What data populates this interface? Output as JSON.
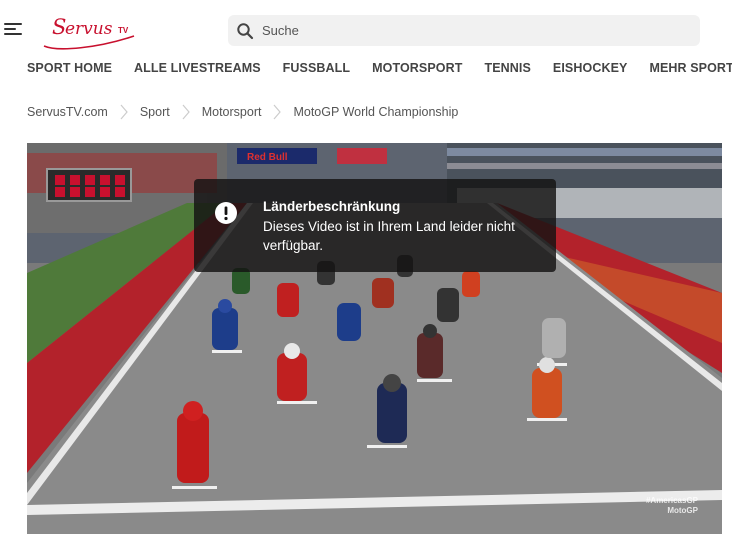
{
  "header": {
    "search_placeholder": "Suche",
    "logo_text": "ServusTV"
  },
  "nav": {
    "items": [
      {
        "label": "SPORT HOME"
      },
      {
        "label": "ALLE LIVESTREAMS"
      },
      {
        "label": "FUSSBALL"
      },
      {
        "label": "MOTORSPORT"
      },
      {
        "label": "TENNIS"
      },
      {
        "label": "EISHOCKEY"
      },
      {
        "label": "MEHR SPORT"
      }
    ]
  },
  "breadcrumb": {
    "items": [
      {
        "label": "ServusTV.com"
      },
      {
        "label": "Sport"
      },
      {
        "label": "Motorsport"
      },
      {
        "label": "MotoGP World Championship"
      }
    ]
  },
  "video": {
    "restriction_title": "Länderbeschränkung",
    "restriction_message": "Dieses Video ist in Ihrem Land leider nicht verfügbar.",
    "watermark_hashtag": "#AmericasGP",
    "watermark_brand": "MotoGP"
  },
  "colors": {
    "brand_red": "#c8102e",
    "overlay_bg": "#141212",
    "track_red": "#b3222b",
    "asphalt": "#8a8a8a"
  }
}
